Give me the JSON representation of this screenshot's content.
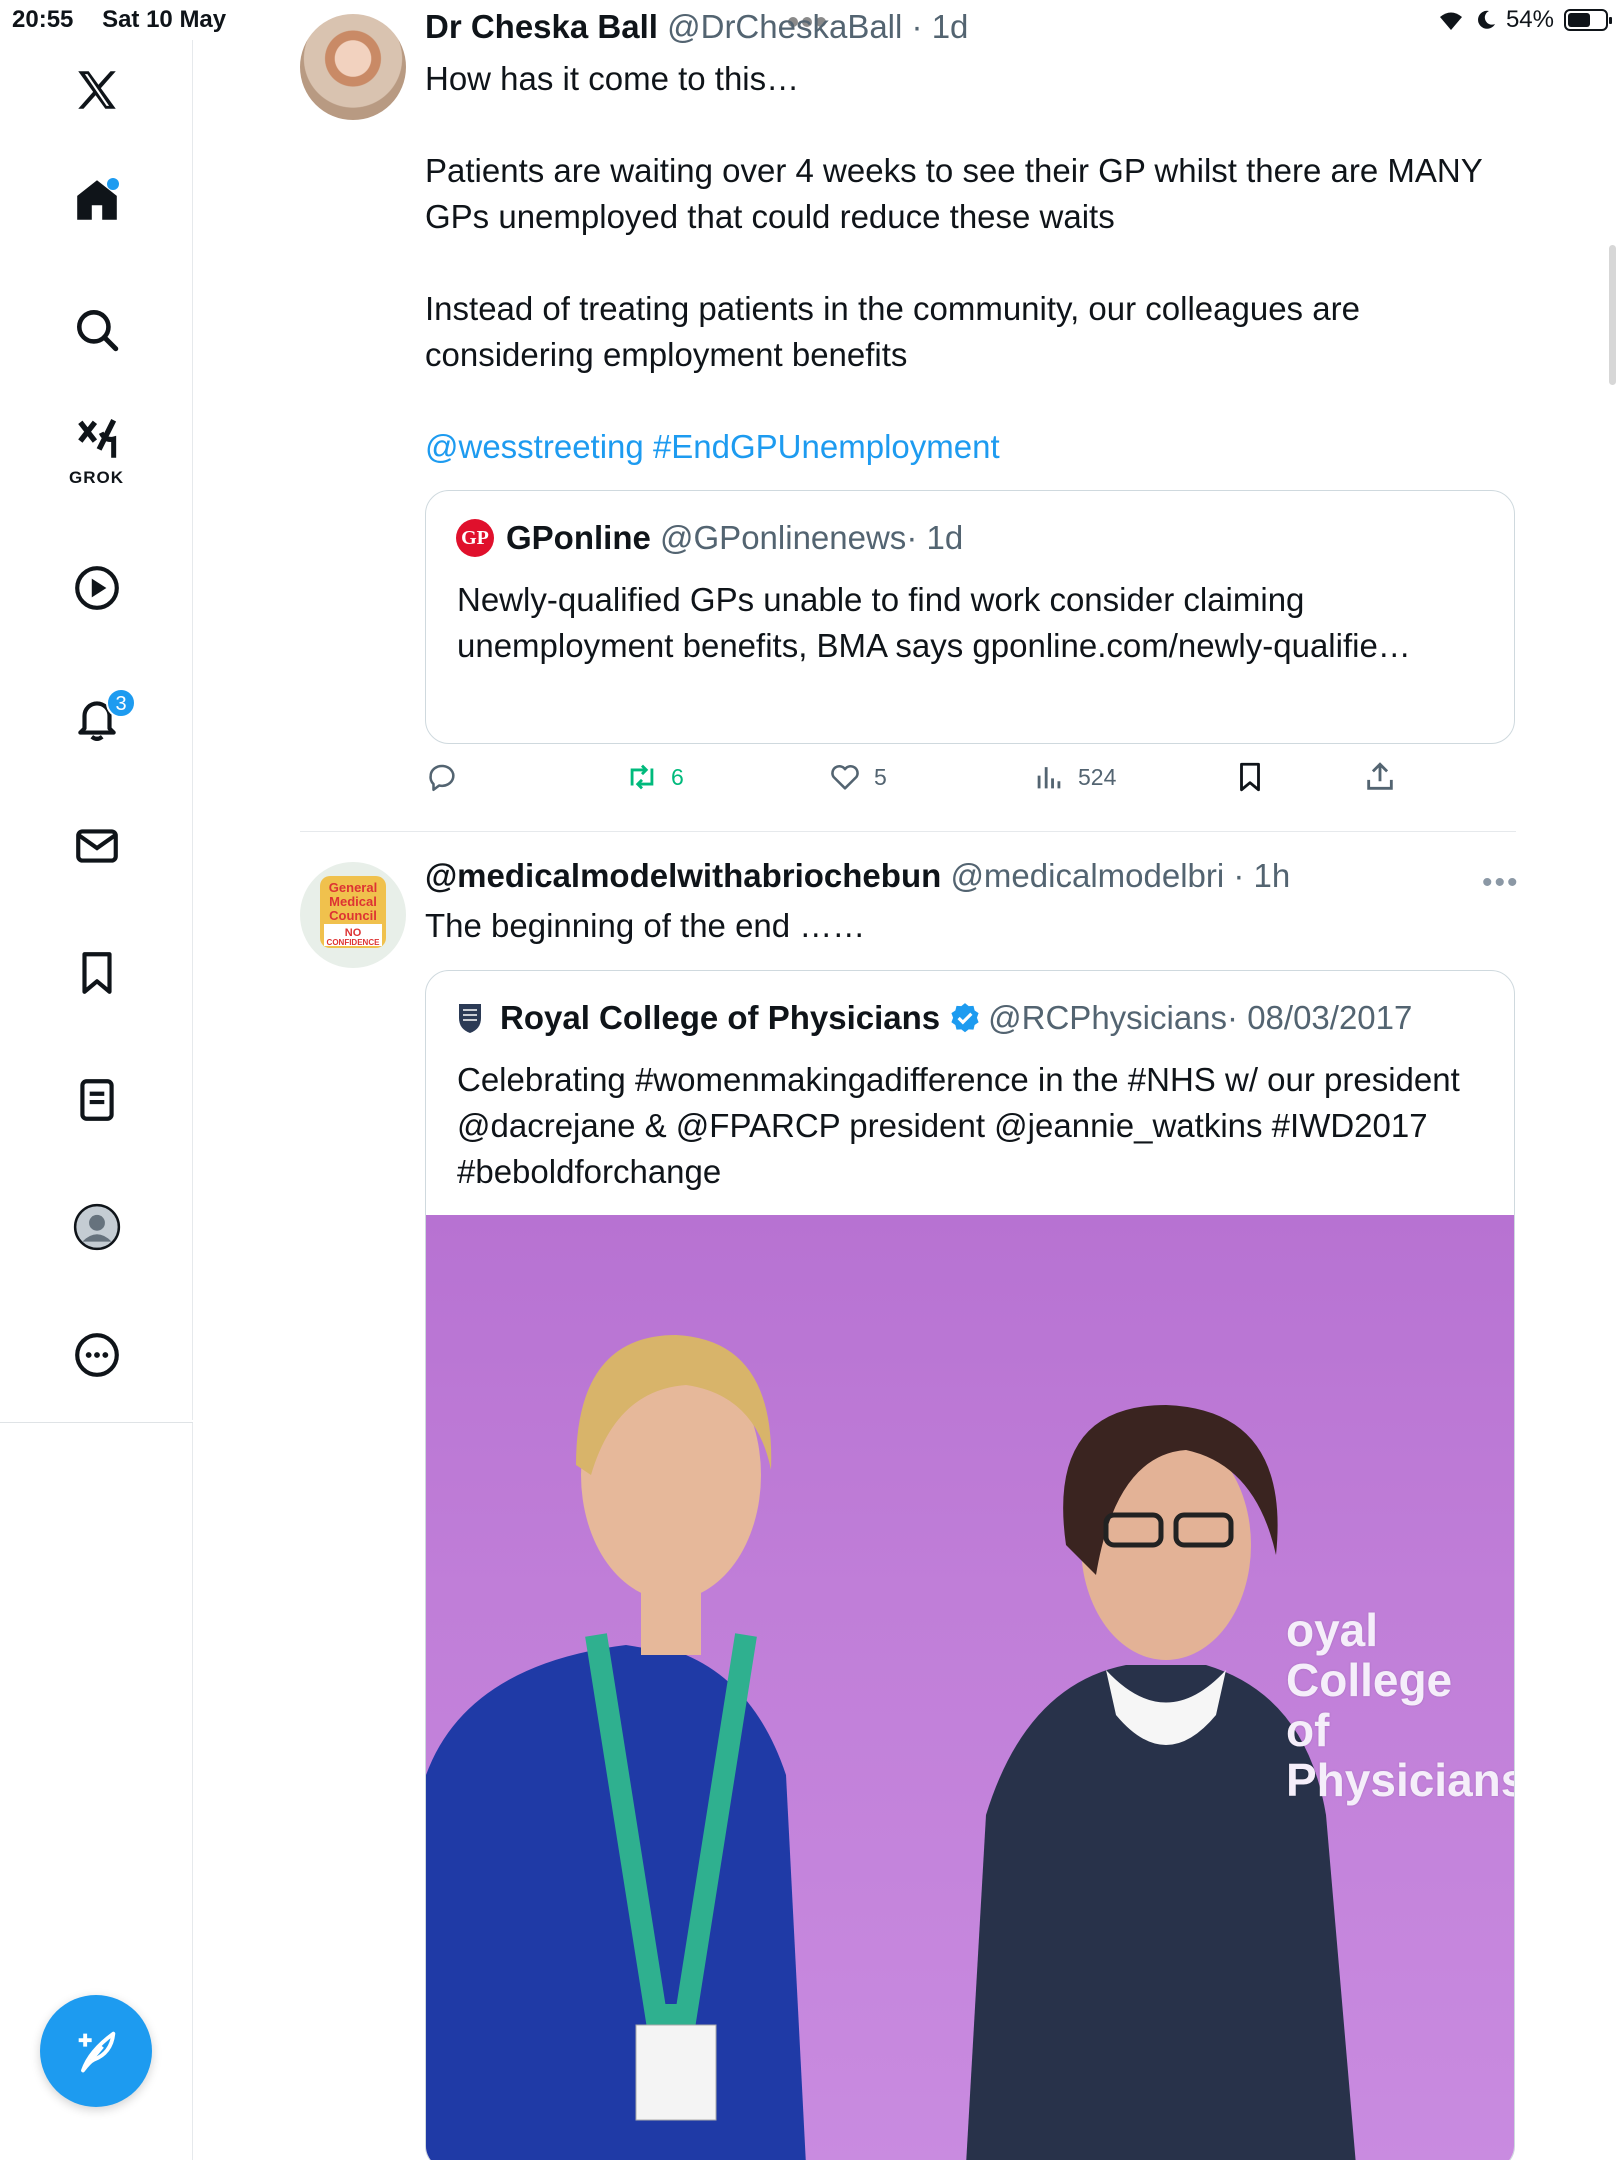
{
  "status_bar": {
    "time": "20:55",
    "date": "Sat 10 May",
    "battery": "54%"
  },
  "sidebar": {
    "grok_label": "GROK",
    "notifications_count": "3"
  },
  "tweets": [
    {
      "name": "Dr Cheska Ball",
      "handle": "@DrCheskaBall",
      "time": "· 1d",
      "paragraphs": [
        "How has it come to this…",
        "Patients are waiting over 4 weeks to see their GP whilst there are MANY GPs unemployed that could reduce these waits",
        "Instead of treating patients in the community, our colleagues are considering employment benefits"
      ],
      "mention": "@wesstreeting",
      "hashtag": "#EndGPUnemployment",
      "quote": {
        "logo_text": "GP",
        "name": "GPonline",
        "handle": "@GPonlinenews",
        "time": "· 1d",
        "text": "Newly-qualified GPs unable to find work consider claiming unemployment benefits, BMA says gponline.com/newly-qualifie…"
      },
      "stats": {
        "retweets": "6",
        "likes": "5",
        "views": "524"
      }
    },
    {
      "name": "@medicalmodelwithabriochebun",
      "handle": "@medicalmodelbri",
      "time": "· 1h",
      "text": "The beginning of the end ……",
      "avatar_text": [
        "General",
        "Medical",
        "Council",
        "NO",
        "CONFIDENCE"
      ],
      "quote": {
        "name": "Royal College of Physicians",
        "handle": "@RCPhysicians",
        "time": "· 08/03/2017",
        "text": "Celebrating #womenmakingadifference in the #NHS w/ our president @dacrejane & @FPARCP president @jeannie_watkins #IWD2017 #beboldforchange",
        "photo_text": [
          "oyal College",
          "of Physicians"
        ]
      }
    }
  ],
  "colors": {
    "accent": "#1d9bf0",
    "retweet": "#00ba7c",
    "muted": "#536471",
    "photo_background": "#c07ed8"
  },
  "icons": [
    "x-logo-icon",
    "home-icon",
    "search-icon",
    "grok-icon",
    "video-icon",
    "bell-icon",
    "mail-icon",
    "bookmark-icon",
    "list-icon",
    "profile-icon",
    "more-icon",
    "compose-icon",
    "reply-icon",
    "retweet-icon",
    "like-icon",
    "views-icon",
    "share-icon"
  ]
}
